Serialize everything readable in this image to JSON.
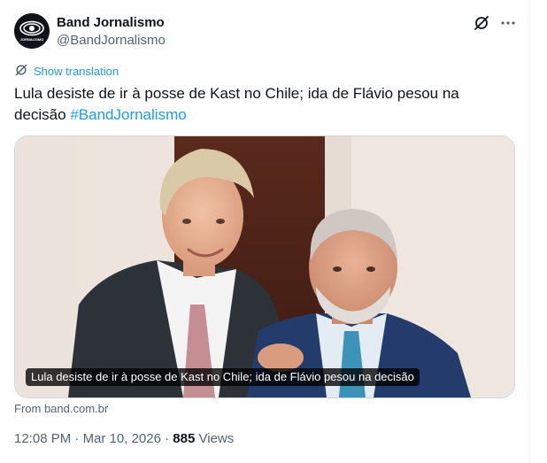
{
  "header": {
    "account_name": "Band Jornalismo",
    "account_handle": "@BandJornalismo",
    "avatar_text": "JORNALISMO"
  },
  "translation": {
    "label": "Show translation"
  },
  "tweet": {
    "text": "Lula desiste de ir à posse de Kast no Chile; ida de Flávio pesou na decisão ",
    "hashtag": "#BandJornalismo"
  },
  "card": {
    "caption": "Lula desiste de ir à posse de Kast no Chile; ida de Flávio pesou na decisão",
    "source": "From band.com.br"
  },
  "meta": {
    "time": "12:08 PM",
    "separator": "·",
    "date": "Mar 10, 2026",
    "views_count": "885",
    "views_label": "Views"
  },
  "icons": [
    "grok-icon",
    "more-icon",
    "translate-icon"
  ],
  "colors": {
    "link": "#1d9bf0",
    "secondary_text": "#536471",
    "text": "#0f1419",
    "border": "#cfd9de"
  }
}
